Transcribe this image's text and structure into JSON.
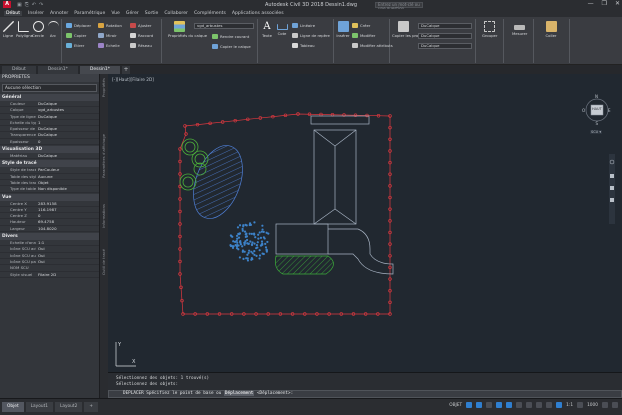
{
  "titlebar": {
    "app_icon": "A",
    "title": "Autodesk Civil 3D 2018   Dessin1.dwg",
    "search_placeholder": "Entrez un mot-clé ou une question",
    "window_controls": [
      "—",
      "❐",
      "✕"
    ],
    "qat": [
      "▣",
      "⎘",
      "↶",
      "↷"
    ]
  },
  "menu_tabs": [
    "Début",
    "Insérer",
    "Annoter",
    "Paramétrique",
    "Vue",
    "Gérer",
    "Sortie",
    "Collaborer",
    "Compléments",
    "Applications associées"
  ],
  "ribbon": {
    "dessin": {
      "title": "Dessin",
      "tools": [
        "Ligne",
        "Polyligne",
        "Cercle",
        "Arc"
      ]
    },
    "modification": {
      "title": "Modification",
      "rows": [
        [
          "Déplacer",
          "Rotation",
          "Ajuster"
        ],
        [
          "Copier",
          "Miroir",
          "Raccord"
        ],
        [
          "Etirer",
          "Echelle",
          "Réseau"
        ]
      ]
    },
    "calques": {
      "title": "Calques",
      "big": "Propriétés du calque",
      "layer_combo": "vgd_arbustes",
      "rows": [
        "Rendre courant",
        "Copier le calque"
      ]
    },
    "annotation": {
      "title": "Annotation",
      "big_text": "Texte",
      "big_dim": "Cote",
      "rows": [
        "Linéaire",
        "Ligne de repère",
        "Tableau"
      ]
    },
    "bloc": {
      "title": "Bloc",
      "big": "Insérer",
      "rows": [
        "Créer",
        "Modifier",
        "Modifier attributs"
      ]
    },
    "proprietes": {
      "title": "Propriétés",
      "big": "Copier les propriétés",
      "combos": [
        "DuCalque",
        "DuCalque",
        "DuCalque"
      ]
    },
    "groupes": {
      "title": "Groupes",
      "big": "Grouper"
    },
    "utilitaires": {
      "title": "Utilitaires",
      "big": "Mesurer"
    },
    "presse": {
      "title": "Presse-papiers",
      "big": "Coller"
    }
  },
  "file_tabs": [
    "Début",
    "Dessin1*",
    "Dessin1*"
  ],
  "palette": {
    "header": "PROPRIETES",
    "selector": "Aucune sélection",
    "side_labels": [
      "Propriétés",
      "Paramètres d'affichage",
      "Informations",
      "Outil de tracé"
    ],
    "categories": [
      {
        "name": "Général",
        "rows": [
          [
            "Couleur",
            "DuCalque"
          ],
          [
            "Calque",
            "vgd_arbustes"
          ],
          [
            "Type de ligne",
            "DuCalque"
          ],
          [
            "Echelle du type de...",
            "1"
          ],
          [
            "Epaisseur de ligne",
            "DuCalque"
          ],
          [
            "Transparence",
            "DuCalque"
          ],
          [
            "Epaisseur",
            "0"
          ]
        ]
      },
      {
        "name": "Visualisation 3D",
        "rows": [
          [
            "Matériau",
            "DuCalque"
          ]
        ]
      },
      {
        "name": "Style de tracé",
        "rows": [
          [
            "Style de tracé",
            "ParCouleur"
          ],
          [
            "Table des styles de...",
            "Aucune"
          ],
          [
            "Table des tracés att...",
            "Objet"
          ],
          [
            "Type de table de tr...",
            "Non disponible"
          ]
        ]
      },
      {
        "name": "Vue",
        "rows": [
          [
            "Centre X",
            "283.9158"
          ],
          [
            "Centre Y",
            "116.1987"
          ],
          [
            "Centre Z",
            "0"
          ],
          [
            "Hauteur",
            "69.4758"
          ],
          [
            "Largeur",
            "104.8020"
          ]
        ]
      },
      {
        "name": "Divers",
        "rows": [
          [
            "Echelle d'annotation",
            "1:1"
          ],
          [
            "Icône SCU activé",
            "Oui"
          ],
          [
            "Icône SCU au point...",
            "Oui"
          ],
          [
            "Icône SCU par fenêt...",
            "Oui"
          ],
          [
            "NOM SCU",
            ""
          ],
          [
            "Style visuel",
            "Filaire 2D"
          ]
        ]
      }
    ]
  },
  "viewport": {
    "label": "[-][Haut][Filaire 2D]",
    "viewcube": {
      "face": "HAUT",
      "n": "N",
      "s": "S",
      "e": "E",
      "o": "O",
      "scu": "SCU ▾"
    }
  },
  "command": {
    "history": [
      "Sélectionnez des objets: 1 trouvé(s)",
      "Sélectionnez des objets:"
    ],
    "prompt": "DEPLACER Spécifiez le point de base ou",
    "option": "Déplacement",
    "tail": " <Déplacement>:"
  },
  "layout_tabs": [
    "Objet",
    "Layout1",
    "Layout2"
  ],
  "status": {
    "mode": "OBJET",
    "scale": "1:1",
    "zoom": "1000"
  },
  "colors": {
    "boundary": "#e0383f",
    "tree": "#4caf3a",
    "hatch_blue": "#4f7fd6",
    "dots": "#3d82c8",
    "house": "#a8b4c4",
    "grass": "#3cae3a"
  }
}
